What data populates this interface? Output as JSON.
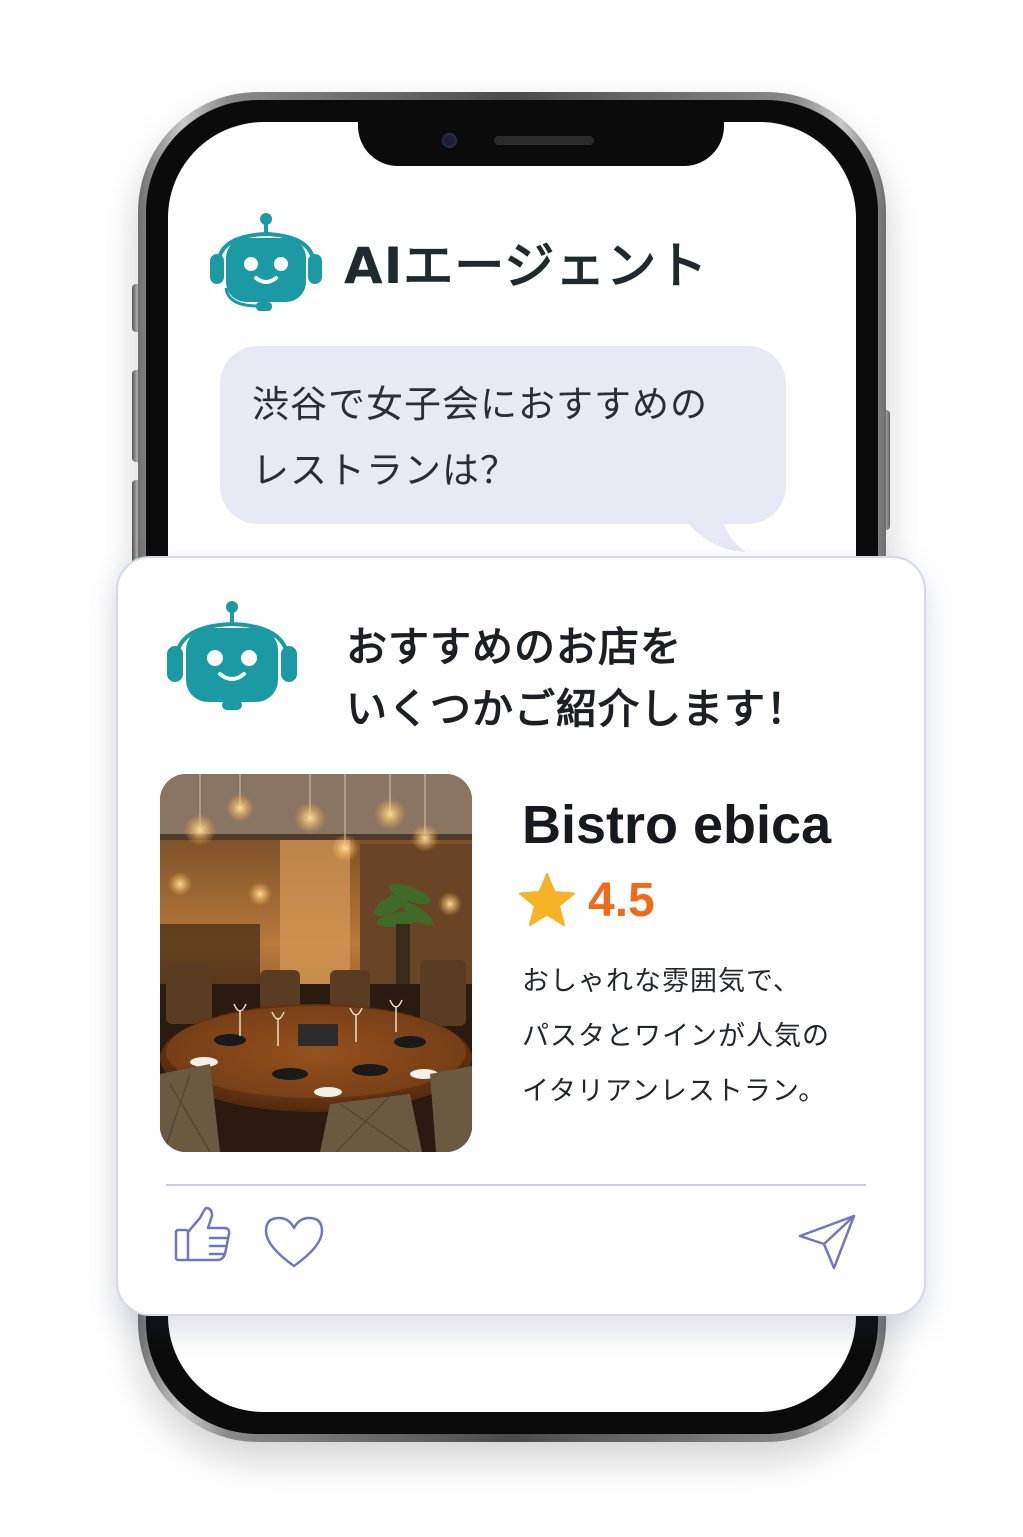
{
  "agent": {
    "title": "AIエージェント",
    "icon": "robot-headset-icon"
  },
  "user_message": {
    "line1": "渋谷で女子会におすすめの",
    "line2": "レストランは？"
  },
  "response": {
    "heading_line1": "おすすめのお店を",
    "heading_line2": "いくつかご紹介します！",
    "restaurant": {
      "name": "Bistro ebica",
      "rating": "4.5",
      "rating_icon": "star-icon",
      "description_line1": "おしゃれな雰囲気で、",
      "description_line2": "パスタとワインが人気の",
      "description_line3": "イタリアンレストラン。",
      "photo": "restaurant-interior-photo"
    },
    "actions": {
      "like_icon": "thumbs-up-icon",
      "favorite_icon": "heart-icon",
      "share_icon": "send-icon"
    }
  },
  "colors": {
    "robot_teal": "#1b9aa3",
    "bubble_bg": "#e7e9f5",
    "rating_orange": "#f06a1c",
    "star_yellow": "#f6b325",
    "action_stroke": "#6f78b8"
  }
}
